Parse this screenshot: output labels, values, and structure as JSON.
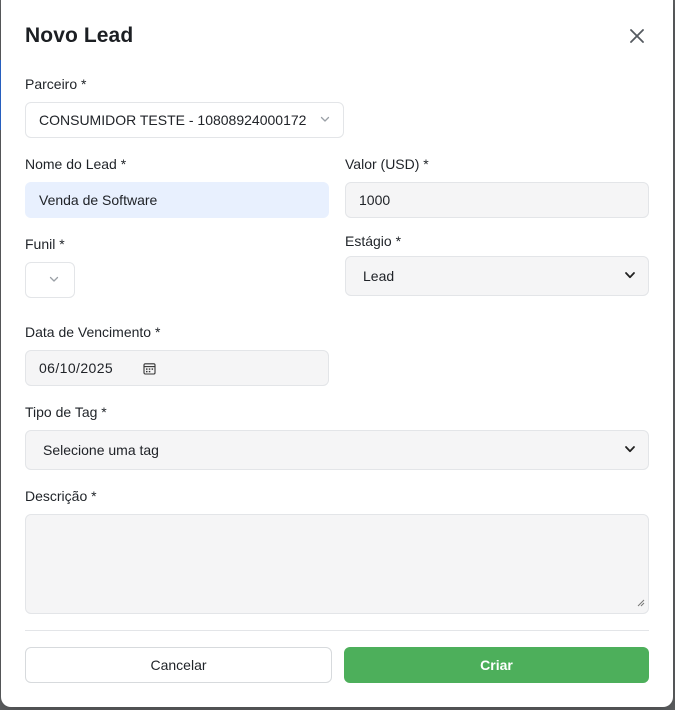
{
  "modal": {
    "title": "Novo Lead",
    "close_icon": "close-icon"
  },
  "form": {
    "partner": {
      "label": "Parceiro *",
      "value": "CONSUMIDOR TESTE - 10808924000172",
      "icon": "chevron-down-icon"
    },
    "lead_name": {
      "label": "Nome do Lead *",
      "value": "Venda de Software"
    },
    "value_usd": {
      "label": "Valor (USD) *",
      "value": "1000"
    },
    "funnel": {
      "label": "Funil *",
      "value": "",
      "icon": "chevron-down-icon"
    },
    "stage": {
      "label": "Estágio *",
      "value": "Lead"
    },
    "due_date": {
      "label": "Data de Vencimento *",
      "value": "06/10/2025",
      "icon": "calendar-icon"
    },
    "tag_type": {
      "label": "Tipo de Tag *",
      "value": "Selecione uma tag"
    },
    "description": {
      "label": "Descrição *",
      "value": ""
    }
  },
  "actions": {
    "cancel_label": "Cancelar",
    "create_label": "Criar"
  },
  "colors": {
    "primary_button": "#4daf5b",
    "autofill_field": "#e8f0fe",
    "backdrop": "#5f6163"
  }
}
